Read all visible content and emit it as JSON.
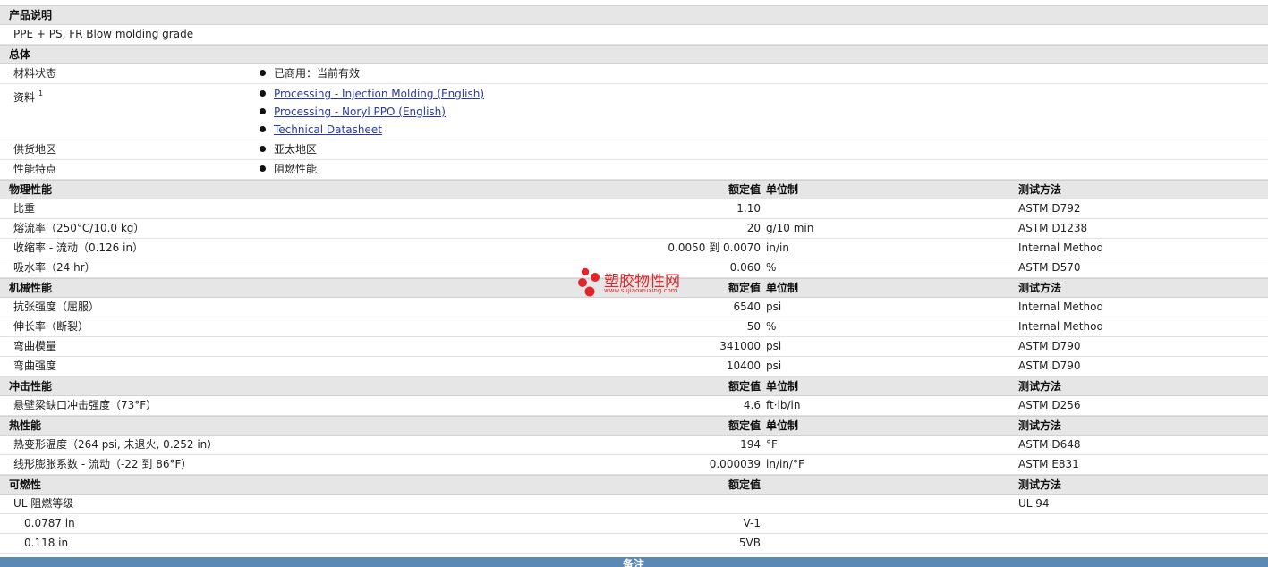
{
  "product": {
    "section_title": "产品说明",
    "description": "PPE + PS, FR Blow molding grade"
  },
  "general": {
    "section_title": "总体",
    "rows": [
      {
        "label": "材料状态",
        "values": [
          "已商用：当前有效"
        ]
      },
      {
        "label": "资料",
        "sup": "1",
        "links": [
          "Processing - Injection Molding (English)",
          "Processing - Noryl PPO (English)",
          "Technical Datasheet"
        ]
      },
      {
        "label": "供货地区",
        "values": [
          "亚太地区"
        ]
      },
      {
        "label": "性能特点",
        "values": [
          "阻燃性能"
        ]
      }
    ]
  },
  "col_headers": {
    "value": "额定值",
    "unit": "单位制",
    "test": "测试方法"
  },
  "physical": {
    "section_title": "物理性能",
    "rows": [
      {
        "label": "比重",
        "value": "1.10",
        "unit": "",
        "test": "ASTM D792"
      },
      {
        "label": "熔流率（250°C/10.0 kg）",
        "value": "20",
        "unit": "g/10 min",
        "test": "ASTM D1238"
      },
      {
        "label": "收缩率 - 流动（0.126 in）",
        "value": "0.0050 到 0.0070",
        "unit": "in/in",
        "test": "Internal Method"
      },
      {
        "label": "吸水率（24 hr）",
        "value": "0.060",
        "unit": "%",
        "test": "ASTM D570"
      }
    ]
  },
  "mechanical": {
    "section_title": "机械性能",
    "rows": [
      {
        "label": "抗张强度（屈服）",
        "value": "6540",
        "unit": "psi",
        "test": "Internal Method"
      },
      {
        "label": "伸长率（断裂）",
        "value": "50",
        "unit": "%",
        "test": "Internal Method"
      },
      {
        "label": "弯曲模量",
        "value": "341000",
        "unit": "psi",
        "test": "ASTM D790"
      },
      {
        "label": "弯曲强度",
        "value": "10400",
        "unit": "psi",
        "test": "ASTM D790"
      }
    ]
  },
  "impact": {
    "section_title": "冲击性能",
    "rows": [
      {
        "label": "悬壁梁缺口冲击强度（73°F）",
        "value": "4.6",
        "unit": "ft·lb/in",
        "test": "ASTM D256"
      }
    ]
  },
  "thermal": {
    "section_title": "热性能",
    "rows": [
      {
        "label": "热变形温度（264 psi, 未退火, 0.252 in）",
        "value": "194",
        "unit": "°F",
        "test": "ASTM D648"
      },
      {
        "label": "线形膨胀系数 - 流动（-22 到 86°F）",
        "value": "0.000039",
        "unit": "in/in/°F",
        "test": "ASTM E831"
      }
    ]
  },
  "flammability": {
    "section_title": "可燃性",
    "rows": [
      {
        "label": "UL 阻燃等级",
        "value": "",
        "unit": "",
        "test": "UL 94",
        "sub": false
      },
      {
        "label": "0.0787 in",
        "value": "V-1",
        "unit": "",
        "test": "",
        "sub": true
      },
      {
        "label": "0.118 in",
        "value": "5VB",
        "unit": "",
        "test": "",
        "sub": true
      }
    ]
  },
  "footer": {
    "label": "备注"
  },
  "watermark": {
    "text": "塑胶物性网",
    "url": "www.sujiaowuxing.com"
  },
  "colors": {
    "section_bg": "#e6e6e6",
    "link": "#2a3b9c",
    "footer_bg": "#5a89b6",
    "watermark": "#e0262b"
  }
}
